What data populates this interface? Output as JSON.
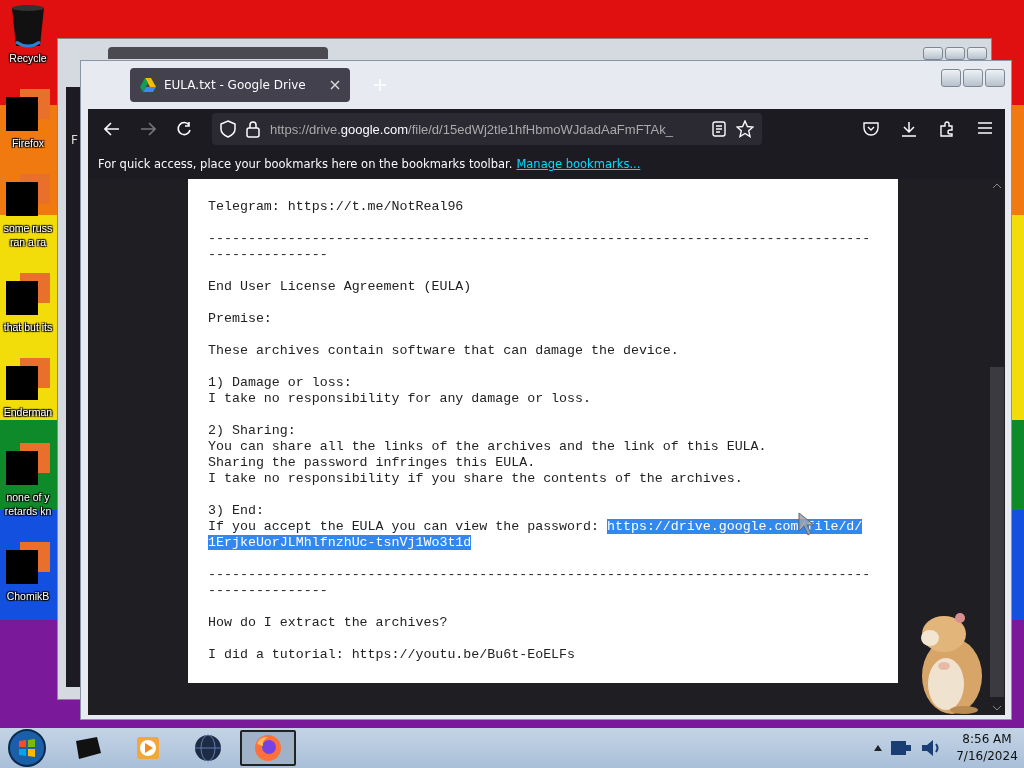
{
  "desktop": {
    "icons": [
      {
        "kind": "bin",
        "label": "Recycle"
      },
      {
        "kind": "redacted",
        "label": "Firefox"
      },
      {
        "kind": "redacted",
        "label": "some russ\nran a ra"
      },
      {
        "kind": "redacted",
        "label": "that but its"
      },
      {
        "kind": "redacted",
        "label": "Enderman"
      },
      {
        "kind": "redacted",
        "label": "none of y\nretards kn"
      },
      {
        "kind": "redacted",
        "label": "ChomikB"
      }
    ]
  },
  "back_window": {
    "text": "F"
  },
  "browser": {
    "tab": {
      "title": "EULA.txt - Google Drive",
      "selected": true
    },
    "url": {
      "prefix": "https://drive.",
      "domain": "google.com",
      "rest": "/file/d/15edWj2tle1hfHbmoWJdadAaFmFTAk_"
    },
    "bookmarks_bar": {
      "message": "For quick access, place your bookmarks here on the bookmarks toolbar.",
      "link": "Manage bookmarks..."
    }
  },
  "document": {
    "blocks": [
      {
        "kind": "text",
        "text": "Telegram: https://t.me/NotReal96"
      },
      {
        "kind": "text",
        "text": "--------------------------------------------------------------------------------------------------"
      },
      {
        "kind": "text",
        "text": "End User License Agreement (EULA)"
      },
      {
        "kind": "text",
        "text": "Premise:"
      },
      {
        "kind": "text",
        "text": "These archives contain software that can damage the device."
      },
      {
        "kind": "text",
        "text": "1) Damage or loss:\nI take no responsibility for any damage or loss."
      },
      {
        "kind": "text",
        "text": "2) Sharing:\nYou can share all the links of the archives and the link of this EULA.\nSharing the password infringes this EULA.\nI take no responsibility if you share the contents of the archives."
      },
      {
        "kind": "selection",
        "text": "3) End:\nIf you accept the EULA you can view the password: ",
        "selection": {
          "text": "https://drive.google.com/file/d/1ErjkeUorJLMhlfnzhUc-tsnVj1Wo3t1d",
          "selected": true
        }
      },
      {
        "kind": "text",
        "text": "--------------------------------------------------------------------------------------------------"
      },
      {
        "kind": "text",
        "text": "How do I extract the archives?"
      },
      {
        "kind": "text",
        "text": "I did a tutorial: https://youtu.be/Bu6t-EoELFs"
      }
    ]
  },
  "taskbar": {
    "apps": [
      {
        "kind": "folder",
        "selected": false
      },
      {
        "kind": "media",
        "selected": false
      },
      {
        "kind": "globe",
        "selected": false
      },
      {
        "kind": "firefox",
        "selected": true
      }
    ],
    "clock": {
      "time": "8:56 AM",
      "date": "7/16/2024"
    }
  }
}
